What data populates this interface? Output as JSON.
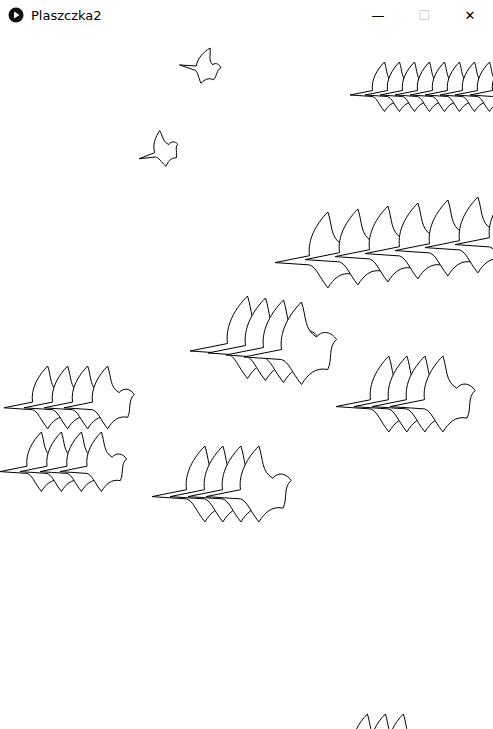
{
  "window": {
    "title": "Plaszczka2",
    "controls": [
      {
        "label": "—",
        "disabled": false
      },
      {
        "label": "☐",
        "disabled": true
      },
      {
        "label": "✕",
        "disabled": false
      }
    ]
  }
}
